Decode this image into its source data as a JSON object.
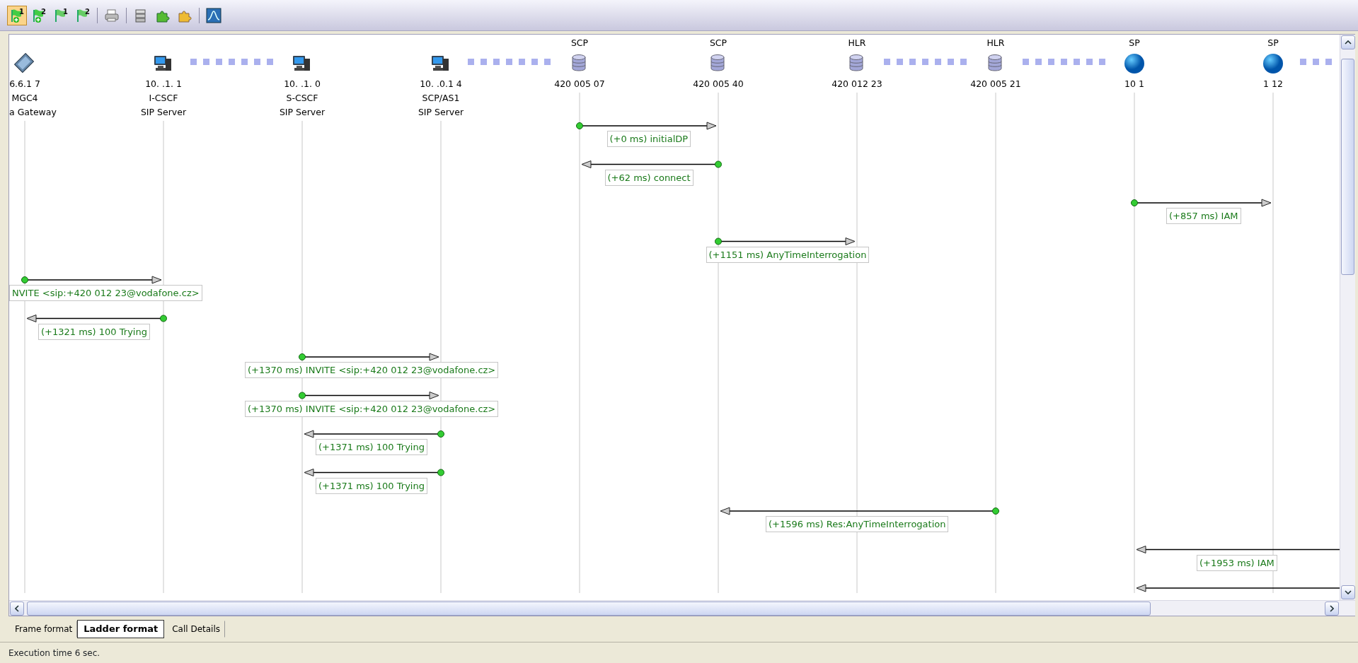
{
  "toolbar": [
    {
      "kind": "flag-add",
      "badge": "1",
      "selected": true,
      "separator_after": false
    },
    {
      "kind": "flag-add",
      "badge": "2",
      "selected": false,
      "separator_after": false
    },
    {
      "kind": "flag",
      "badge": "1",
      "selected": false,
      "separator_after": false
    },
    {
      "kind": "flag",
      "badge": "2",
      "selected": false,
      "separator_after": true
    },
    {
      "kind": "printer",
      "selected": false,
      "separator_after": true
    },
    {
      "kind": "stack",
      "selected": false,
      "separator_after": false
    },
    {
      "kind": "puzzle-green",
      "selected": false,
      "separator_after": false
    },
    {
      "kind": "puzzle-yellow",
      "selected": false,
      "separator_after": true
    },
    {
      "kind": "chart",
      "selected": false,
      "separator_after": false
    }
  ],
  "participants": [
    {
      "kind": "gateway",
      "address": "6.6.1 7",
      "name": "MGC4",
      "role": "a Gateway",
      "separator_after": false
    },
    {
      "kind": "computer",
      "address": "10. .1. 1",
      "name": "I-CSCF",
      "role": "SIP Server",
      "separator_after": true
    },
    {
      "kind": "computer",
      "address": "10. .1. 0",
      "name": "S-CSCF",
      "role": "SIP Server",
      "separator_after": false
    },
    {
      "kind": "computer",
      "address": "10. .0.1 4",
      "name": "SCP/AS1",
      "role": "SIP Server",
      "separator_after": true
    },
    {
      "kind": "database",
      "type": "SCP",
      "address": "420    005 07",
      "separator_after": false
    },
    {
      "kind": "database",
      "type": "SCP",
      "address": "420    005 40",
      "separator_after": false
    },
    {
      "kind": "database",
      "type": "HLR",
      "address": "420    012 23",
      "separator_after": true
    },
    {
      "kind": "database",
      "type": "HLR",
      "address": "420    005 21",
      "separator_after": true
    },
    {
      "kind": "sphere",
      "type": "SP",
      "address": "10 1",
      "separator_after": false
    },
    {
      "kind": "sphere",
      "type": "SP",
      "address": "1 12",
      "separator_after": true
    }
  ],
  "messages": [
    {
      "lanes": [
        {
          "kind": "idle"
        },
        {
          "kind": "idle"
        },
        {
          "kind": "idle"
        },
        {
          "kind": "idle"
        },
        {
          "kind": "sender"
        },
        {
          "kind": "receiver"
        }
      ],
      "label": "(+0 ms) initialDP"
    },
    {
      "lanes": [
        {
          "kind": "idle"
        },
        {
          "kind": "idle"
        },
        {
          "kind": "idle"
        },
        {
          "kind": "idle"
        },
        {
          "kind": "receiver"
        },
        {
          "kind": "sender"
        }
      ],
      "label": "(+62 ms) connect"
    },
    {
      "lanes": [
        {
          "kind": "idle"
        },
        {
          "kind": "idle"
        },
        {
          "kind": "idle"
        },
        {
          "kind": "idle"
        },
        {
          "kind": "idle"
        },
        {
          "kind": "idle"
        },
        {
          "kind": "idle"
        },
        {
          "kind": "idle"
        },
        {
          "kind": "sender"
        },
        {
          "kind": "receiver"
        }
      ],
      "label": "(+857 ms) IAM"
    },
    {
      "lanes": [
        {
          "kind": "idle"
        },
        {
          "kind": "idle"
        },
        {
          "kind": "idle"
        },
        {
          "kind": "idle"
        },
        {
          "kind": "idle"
        },
        {
          "kind": "sender"
        },
        {
          "kind": "receiver"
        }
      ],
      "label": "(+1151 ms) AnyTimeInterrogation"
    },
    {
      "lanes": [
        {
          "kind": "sender"
        },
        {
          "kind": "receiver"
        }
      ],
      "label": "NVITE <sip:+420    012 23@vodafone.cz>"
    },
    {
      "lanes": [
        {
          "kind": "receiver"
        },
        {
          "kind": "sender"
        }
      ],
      "label": "(+1321 ms) 100 Trying"
    },
    {
      "lanes": [
        {
          "kind": "idle"
        },
        {
          "kind": "idle"
        },
        {
          "kind": "sender"
        },
        {
          "kind": "receiver"
        }
      ],
      "label": "(+1370 ms) INVITE <sip:+420    012 23@vodafone.cz>"
    },
    {
      "lanes": [
        {
          "kind": "idle"
        },
        {
          "kind": "idle"
        },
        {
          "kind": "sender"
        },
        {
          "kind": "receiver"
        }
      ],
      "label": "(+1370 ms) INVITE <sip:+420    012 23@vodafone.cz>"
    },
    {
      "lanes": [
        {
          "kind": "idle"
        },
        {
          "kind": "idle"
        },
        {
          "kind": "receiver"
        },
        {
          "kind": "sender"
        }
      ],
      "label": "(+1371 ms) 100 Trying"
    },
    {
      "lanes": [
        {
          "kind": "idle"
        },
        {
          "kind": "idle"
        },
        {
          "kind": "receiver"
        },
        {
          "kind": "sender"
        }
      ],
      "label": "(+1371 ms) 100 Trying"
    },
    {
      "lanes": [
        {
          "kind": "idle"
        },
        {
          "kind": "idle"
        },
        {
          "kind": "idle"
        },
        {
          "kind": "idle"
        },
        {
          "kind": "idle"
        },
        {
          "kind": "receiver"
        },
        {
          "kind": "idle"
        },
        {
          "kind": "sender"
        }
      ],
      "label": "(+1596 ms) Res:AnyTimeInterrogation"
    },
    {
      "lanes": [
        {
          "kind": "idle"
        },
        {
          "kind": "idle"
        },
        {
          "kind": "idle"
        },
        {
          "kind": "idle"
        },
        {
          "kind": "idle"
        },
        {
          "kind": "idle"
        },
        {
          "kind": "idle"
        },
        {
          "kind": "idle"
        },
        {
          "kind": "receiver"
        },
        {
          "kind": "idle"
        },
        {
          "kind": "sender"
        }
      ],
      "label": "(+1953 ms) IAM"
    },
    {
      "lanes": [
        {
          "kind": "idle"
        },
        {
          "kind": "idle"
        },
        {
          "kind": "idle"
        },
        {
          "kind": "idle"
        },
        {
          "kind": "idle"
        },
        {
          "kind": "idle"
        },
        {
          "kind": "idle"
        },
        {
          "kind": "idle"
        },
        {
          "kind": "receiver"
        },
        {
          "kind": "idle"
        },
        {
          "kind": "sender"
        }
      ]
    }
  ],
  "tabs": [
    {
      "label": "Frame format",
      "selected": false
    },
    {
      "label": "Ladder format",
      "selected": true
    },
    {
      "label": "Call Details",
      "selected": false
    }
  ],
  "status_bar": "Execution time 6 sec."
}
